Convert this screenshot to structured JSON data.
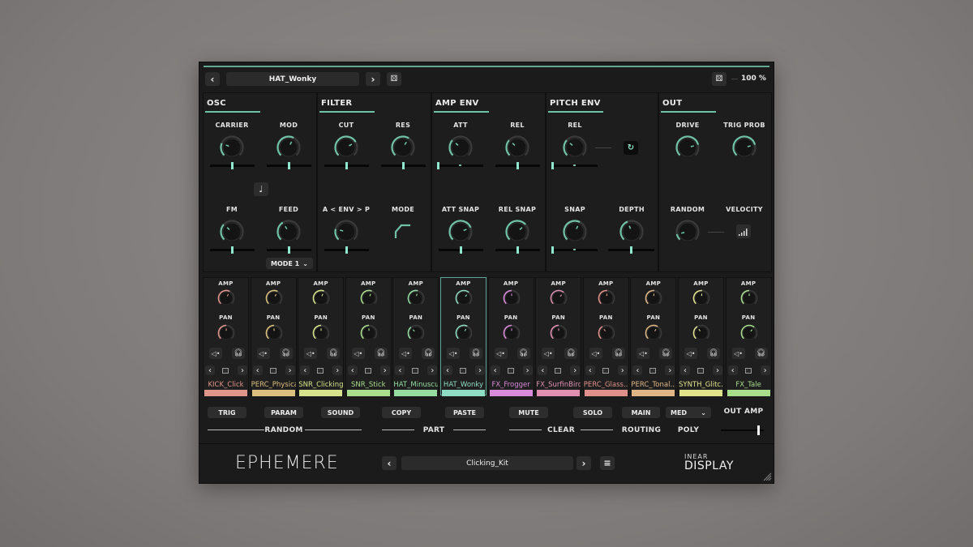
{
  "header": {
    "preset_name": "HAT_Wonky",
    "zoom_label": "100 %",
    "prev_icon": "chevron-left-icon",
    "next_icon": "chevron-right-icon",
    "dice_icon": "dice-icon"
  },
  "accent_color": "#6fc2a8",
  "sections": {
    "osc": {
      "title": "OSC",
      "carrier": "CARRIER",
      "mod": "MOD",
      "fm": "FM",
      "feed": "FEED",
      "mode_select": "MODE 1"
    },
    "filter": {
      "title": "FILTER",
      "cut": "CUT",
      "res": "RES",
      "env": "A < ENV > P",
      "mode": "MODE"
    },
    "amp_env": {
      "title": "AMP ENV",
      "att": "ATT",
      "rel": "REL",
      "att_snap": "ATT SNAP",
      "rel_snap": "REL SNAP"
    },
    "pitch_env": {
      "title": "PITCH ENV",
      "rel": "REL",
      "snap": "SNAP",
      "depth": "DEPTH"
    },
    "out": {
      "title": "OUT",
      "drive": "DRIVE",
      "trig_prob": "TRIG PROB",
      "random": "RANDOM",
      "velocity": "VELOCITY"
    }
  },
  "knob_values": {
    "carrier": 0.25,
    "mod": 0.6,
    "cut": 0.72,
    "res": 0.62,
    "att": 0.32,
    "rel_amp": 0.32,
    "fm": 0.32,
    "feed": 0.38,
    "env": 0.22,
    "att_snap": 0.75,
    "rel_snap": 0.68,
    "rel_pitch": 0.32,
    "snap": 0.6,
    "depth": 0.42,
    "drive": 0.78,
    "trig_prob": 0.78,
    "random": 0.12
  },
  "channel_labels": {
    "amp": "AMP",
    "pan": "PAN"
  },
  "channels": [
    {
      "name": "KICK_Click",
      "color": "#e0958a",
      "amp": 0.6,
      "pan": 0.5
    },
    {
      "name": "PERC_Physical",
      "color": "#dcc07e",
      "amp": 0.6,
      "pan": 0.5
    },
    {
      "name": "SNR_Clicking",
      "color": "#d6e38c",
      "amp": 0.58,
      "pan": 0.5
    },
    {
      "name": "SNR_Stick",
      "color": "#a8dd8c",
      "amp": 0.58,
      "pan": 0.5
    },
    {
      "name": "HAT_Minuscule",
      "color": "#94dca0",
      "amp": 0.55,
      "pan": 0.35
    },
    {
      "name": "HAT_Wonky",
      "color": "#8fdcc4",
      "amp": 0.65,
      "pan": 0.6,
      "selected": true
    },
    {
      "name": "FX_Frogger",
      "color": "#d98ad9",
      "amp": 0.5,
      "pan": 0.5
    },
    {
      "name": "FX_SurfinBird",
      "color": "#e08fb0",
      "amp": 0.65,
      "pan": 0.5
    },
    {
      "name": "PERC_Glass...",
      "color": "#e0908a",
      "amp": 0.52,
      "pan": 0.38
    },
    {
      "name": "PERC_Tonal...",
      "color": "#e0b585",
      "amp": 0.52,
      "pan": 0.62
    },
    {
      "name": "SYNTH_Glitc...",
      "color": "#dfe38c",
      "amp": 0.52,
      "pan": 0.38
    },
    {
      "name": "FX_Tale",
      "color": "#a8dd8c",
      "amp": 0.5,
      "pan": 0.65
    }
  ],
  "bottom": {
    "random": {
      "label": "RANDOM",
      "trig": "TRIG",
      "param": "PARAM",
      "sound": "SOUND"
    },
    "part": {
      "label": "PART",
      "copy": "COPY",
      "paste": "PASTE"
    },
    "clear": {
      "label": "CLEAR",
      "mute": "MUTE",
      "solo": "SOLO"
    },
    "routing": {
      "label": "ROUTING",
      "value": "MAIN"
    },
    "poly": {
      "label": "POLY",
      "value": "MED"
    },
    "out_amp": {
      "label": "OUT AMP",
      "value": 0.9
    }
  },
  "footer": {
    "logo": "EPHEMERE",
    "kit_name": "Clicking_Kit",
    "brand_top": "INEAR",
    "brand_bottom": "DISPLAY"
  }
}
